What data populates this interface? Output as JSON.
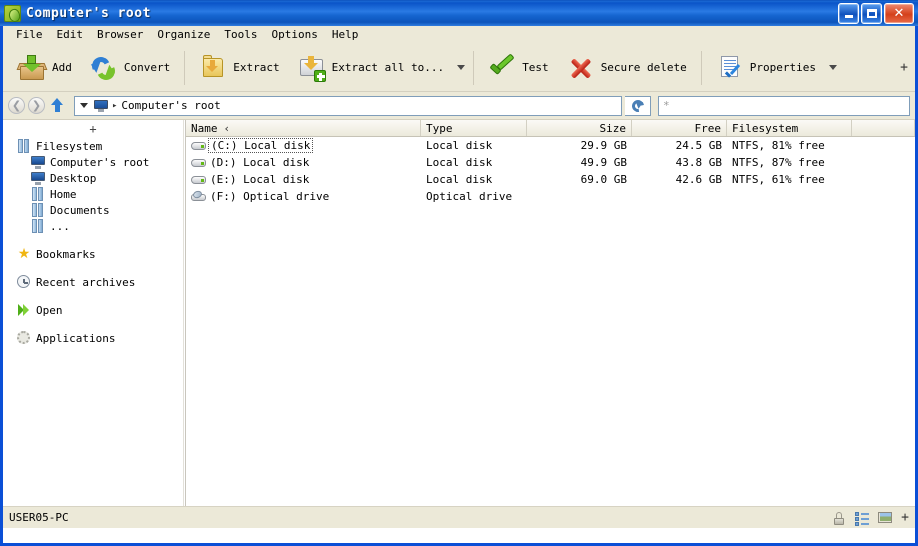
{
  "window": {
    "title": "Computer's root",
    "app_icon": "peazip-logo-icon",
    "buttons": {
      "minimize": "minimize-button",
      "maximize": "maximize-button",
      "close": "close-button"
    }
  },
  "menubar": {
    "items": [
      {
        "label": "File"
      },
      {
        "label": "Edit"
      },
      {
        "label": "Browser"
      },
      {
        "label": "Organize"
      },
      {
        "label": "Tools"
      },
      {
        "label": "Options"
      },
      {
        "label": "Help"
      }
    ]
  },
  "toolbar": {
    "buttons": [
      {
        "label": "Add",
        "icon": "add-box-icon",
        "dropdown": false
      },
      {
        "label": "Convert",
        "icon": "convert-arrows-icon",
        "dropdown": false
      },
      {
        "label": "Extract",
        "icon": "extract-folder-icon",
        "dropdown": false
      },
      {
        "label": "Extract all to...",
        "icon": "extract-all-drive-icon",
        "dropdown": true
      },
      {
        "label": "Test",
        "icon": "green-check-icon",
        "dropdown": false
      },
      {
        "label": "Secure delete",
        "icon": "red-x-icon",
        "dropdown": false
      },
      {
        "label": "Properties",
        "icon": "document-check-icon",
        "dropdown": true
      }
    ],
    "overflow_label": "+"
  },
  "addressbar": {
    "back": "back-icon",
    "forward": "forward-icon",
    "up": "up-icon",
    "location_icon": "computer-monitor-icon",
    "breadcrumb_separator": "▸",
    "breadcrumb": "Computer's root",
    "refresh_icon": "refresh-icon",
    "filter_value": "*",
    "filter_placeholder": "*"
  },
  "sidebar": {
    "expand_label": "+",
    "groups": [
      {
        "items": [
          {
            "label": "Filesystem",
            "icon": "hard-disk-icon",
            "indent": false
          },
          {
            "label": "Computer's root",
            "icon": "computer-monitor-icon",
            "indent": true
          },
          {
            "label": "Desktop",
            "icon": "computer-monitor-icon",
            "indent": true
          },
          {
            "label": "Home",
            "icon": "hard-disk-icon",
            "indent": true
          },
          {
            "label": "Documents",
            "icon": "hard-disk-icon",
            "indent": true
          },
          {
            "label": "...",
            "icon": "hard-disk-icon",
            "indent": true
          }
        ]
      },
      {
        "items": [
          {
            "label": "Bookmarks",
            "icon": "star-icon",
            "indent": false
          }
        ]
      },
      {
        "items": [
          {
            "label": "Recent archives",
            "icon": "clock-icon",
            "indent": false
          }
        ]
      },
      {
        "items": [
          {
            "label": "Open",
            "icon": "play-forward-icon",
            "indent": false
          }
        ]
      },
      {
        "items": [
          {
            "label": "Applications",
            "icon": "gear-icon",
            "indent": false
          }
        ]
      }
    ]
  },
  "filelist": {
    "columns": [
      {
        "key": "name",
        "label": "Name",
        "sort": "‹"
      },
      {
        "key": "type",
        "label": "Type",
        "sort": ""
      },
      {
        "key": "size",
        "label": "Size",
        "sort": ""
      },
      {
        "key": "free",
        "label": "Free",
        "sort": ""
      },
      {
        "key": "filesystem",
        "label": "Filesystem",
        "sort": ""
      },
      {
        "key": "rest",
        "label": "",
        "sort": ""
      }
    ],
    "rows": [
      {
        "icon": "hard-disk-drive-icon",
        "name": "(C:) Local disk",
        "type": "Local disk",
        "size": "29.9 GB",
        "free": "24.5 GB",
        "filesystem": "NTFS, 81% free",
        "focused": true
      },
      {
        "icon": "hard-disk-drive-icon",
        "name": "(D:) Local disk",
        "type": "Local disk",
        "size": "49.9 GB",
        "free": "43.8 GB",
        "filesystem": "NTFS, 87% free",
        "focused": false
      },
      {
        "icon": "hard-disk-drive-icon",
        "name": "(E:) Local disk",
        "type": "Local disk",
        "size": "69.0 GB",
        "free": "42.6 GB",
        "filesystem": "NTFS, 61% free",
        "focused": false
      },
      {
        "icon": "optical-drive-icon",
        "name": "(F:) Optical drive",
        "type": "Optical drive",
        "size": "",
        "free": "",
        "filesystem": "",
        "focused": false
      }
    ]
  },
  "statusbar": {
    "text": "USER05-PC",
    "icons": [
      {
        "name": "lock-icon"
      },
      {
        "name": "details-list-icon"
      },
      {
        "name": "thumbnail-image-icon"
      }
    ],
    "plus_label": "+"
  },
  "colors": {
    "titlebar_blue": "#0a54c8",
    "window_border": "#0a4fd6",
    "chrome_beige": "#ece9d8",
    "list_background": "#ffffff",
    "close_red": "#d4401a",
    "accent_green": "#6cc72b"
  }
}
